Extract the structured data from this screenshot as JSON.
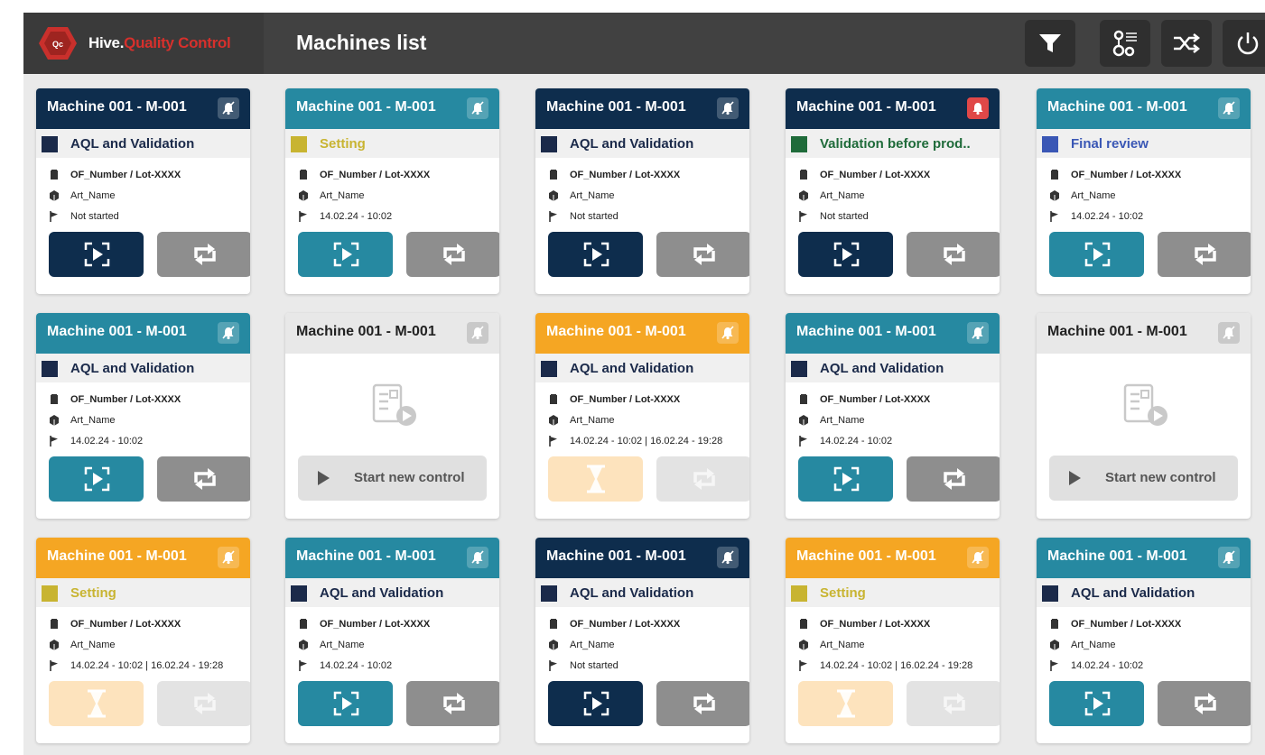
{
  "app": {
    "brand_part1": "Hive.",
    "brand_part2": "Quality Control",
    "logo_text": "Qc",
    "page_title": "Machines list"
  },
  "colors": {
    "navy": "#0e2d4d",
    "teal": "#2689a1",
    "orange": "#f5a623",
    "gray_head": "#e8e8e8",
    "status_navy": "#1b2a4a",
    "status_yellow": "#c8b431",
    "status_green": "#1f6b3a",
    "status_blue": "#3a57b5",
    "brand_red": "#d6302c"
  },
  "toolbar": {
    "filter_icon": "filter-icon",
    "settings_icon": "settings-icon",
    "shuffle_icon": "shuffle-icon",
    "power_icon": "power-icon"
  },
  "cards": [
    {
      "title": "Machine 001 -  M-001",
      "theme": "navy",
      "status": "AQL and Validation",
      "status_color": "navy",
      "of": "OF_Number / Lot-XXXX",
      "art": "Art_Name",
      "date": "Not started",
      "primary": "play",
      "sync_disabled": false,
      "alert": false
    },
    {
      "title": "Machine 001 -  M-001",
      "theme": "teal",
      "status": "Setting",
      "status_color": "yellow",
      "of": "OF_Number / Lot-XXXX",
      "art": "Art_Name",
      "date": "14.02.24 - 10:02",
      "primary": "play",
      "sync_disabled": false,
      "alert": false
    },
    {
      "title": "Machine 001 -  M-001",
      "theme": "navy",
      "status": "AQL and Validation",
      "status_color": "navy",
      "of": "OF_Number / Lot-XXXX",
      "art": "Art_Name",
      "date": "Not started",
      "primary": "play",
      "sync_disabled": false,
      "alert": false
    },
    {
      "title": "Machine 001 -  M-001",
      "theme": "navy",
      "status": "Validation before prod..",
      "status_color": "green",
      "of": "OF_Number / Lot-XXXX",
      "art": "Art_Name",
      "date": "Not started",
      "primary": "play",
      "sync_disabled": false,
      "alert": true
    },
    {
      "title": "Machine 001 -  M-001",
      "theme": "teal",
      "status": "Final review",
      "status_color": "blue",
      "of": "OF_Number / Lot-XXXX",
      "art": "Art_Name",
      "date": "14.02.24 - 10:02",
      "primary": "play",
      "sync_disabled": false,
      "alert": false
    },
    {
      "title": "Machine 001 -  M-001",
      "theme": "teal",
      "status": "AQL and Validation",
      "status_color": "navy",
      "of": "OF_Number / Lot-XXXX",
      "art": "Art_Name",
      "date": "14.02.24 - 10:02",
      "primary": "play",
      "sync_disabled": false,
      "alert": false
    },
    {
      "title": "Machine 001 -  M-001",
      "theme": "empty",
      "start_label": "Start new control"
    },
    {
      "title": "Machine 001 -  M-001",
      "theme": "orange",
      "status": "AQL and Validation",
      "status_color": "navy",
      "of": "OF_Number / Lot-XXXX",
      "art": "Art_Name",
      "date": "14.02.24 - 10:02  |  16.02.24 - 19:28",
      "primary": "hourglass",
      "sync_disabled": true,
      "alert": false
    },
    {
      "title": "Machine 001 -  M-001",
      "theme": "teal",
      "status": "AQL and Validation",
      "status_color": "navy",
      "of": "OF_Number / Lot-XXXX",
      "art": "Art_Name",
      "date": "14.02.24 - 10:02",
      "primary": "play",
      "sync_disabled": false,
      "alert": false
    },
    {
      "title": "Machine 001 -  M-001",
      "theme": "empty",
      "start_label": "Start new control"
    },
    {
      "title": "Machine 001 -  M-001",
      "theme": "orange",
      "status": "Setting",
      "status_color": "yellow",
      "of": "OF_Number / Lot-XXXX",
      "art": "Art_Name",
      "date": "14.02.24 - 10:02  |  16.02.24 - 19:28",
      "primary": "hourglass",
      "sync_disabled": true,
      "alert": false
    },
    {
      "title": "Machine 001 -  M-001",
      "theme": "teal",
      "status": "AQL and Validation",
      "status_color": "navy",
      "of": "OF_Number / Lot-XXXX",
      "art": "Art_Name",
      "date": "14.02.24 - 10:02",
      "primary": "play",
      "sync_disabled": false,
      "alert": false
    },
    {
      "title": "Machine 001 -  M-001",
      "theme": "navy",
      "status": "AQL and Validation",
      "status_color": "navy",
      "of": "OF_Number / Lot-XXXX",
      "art": "Art_Name",
      "date": "Not started",
      "primary": "play",
      "sync_disabled": false,
      "alert": false
    },
    {
      "title": "Machine 001 -  M-001",
      "theme": "orange",
      "status": "Setting",
      "status_color": "yellow",
      "of": "OF_Number / Lot-XXXX",
      "art": "Art_Name",
      "date": "14.02.24 - 10:02  |  16.02.24 - 19:28",
      "primary": "hourglass",
      "sync_disabled": true,
      "alert": false
    },
    {
      "title": "Machine 001 -  M-001",
      "theme": "teal",
      "status": "AQL and Validation",
      "status_color": "navy",
      "of": "OF_Number / Lot-XXXX",
      "art": "Art_Name",
      "date": "14.02.24 - 10:02",
      "primary": "play",
      "sync_disabled": false,
      "alert": false
    }
  ]
}
